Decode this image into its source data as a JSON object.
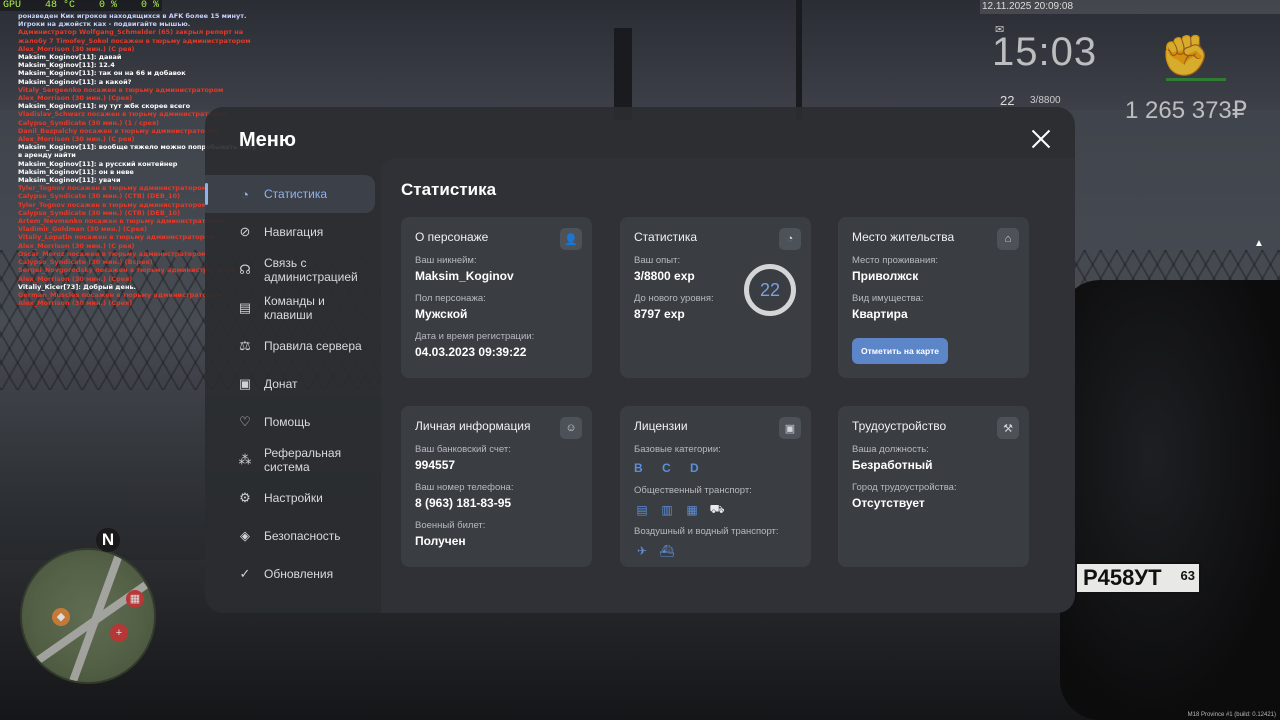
{
  "hud": {
    "gpu": "GPU    48 °C    0 %    0 %",
    "date": "12.11.2025 20:09:08",
    "time": "15:03",
    "level": "22",
    "exp": "3/8800",
    "money": "1 265 373₽",
    "build": "M18 Province #1 (build: 0.12421)",
    "mail_icon": "mail-icon",
    "fist_icon": "fist-icon"
  },
  "chat": [
    {
      "t": "ронзведен Кик игроков находящихся в AFK более 15 минут. Игроки на джойстк ках - подвигайте мышью.",
      "c": "c-b"
    },
    {
      "t": "Администратор Wolfgang_Schmelder (65) закрыл репорт на жалобу 7 Timofey_Sokol посажен в тюрьму администратором Alex_Morrison (30 мин.) (С рея)",
      "c": "c-r"
    },
    {
      "t": "Maksim_Koginov[11]: давай",
      "c": "c-w"
    },
    {
      "t": "Maksim_Koginov[11]: 12.4",
      "c": "c-w"
    },
    {
      "t": "Maksim_Koginov[11]: так он на 66 и добавок",
      "c": "c-w"
    },
    {
      "t": "Maksim_Koginov[11]: а какой?",
      "c": "c-w"
    },
    {
      "t": "Vitaly_Sergeenko посажен в тюрьму администратором Alex_Morrison (30 мин.) (Срея)",
      "c": "c-r"
    },
    {
      "t": "Maksim_Koginov[11]: ну тут жбк скорее всего",
      "c": "c-w"
    },
    {
      "t": "Vladislav_Schwarz посажен в тюрьму администратором Calypso_Syndicate (30 мин.) (1 / срея)",
      "c": "c-r"
    },
    {
      "t": "Danil_Bezpalchy посажен в тюрьму администратором Alex_Morrison (30 мин.) (С рея)",
      "c": "c-r"
    },
    {
      "t": "Maksim_Koginov[11]: вообще тяжело можно попробывать хату в аренду найти",
      "c": "c-w"
    },
    {
      "t": "Maksim_Koginov[11]: а русский контейнер",
      "c": "c-w"
    },
    {
      "t": "Maksim_Koginov[11]: он в неве",
      "c": "c-w"
    },
    {
      "t": "Maksim_Koginov[11]: увачи",
      "c": "c-w"
    },
    {
      "t": "Tyler_Tognov посажен в тюрьму администратором Calypso_Syndicate (30 мин.) (СТВ) (DEB_10)",
      "c": "c-r"
    },
    {
      "t": "Tyler_Tognov посажен в тюрьму администратором Calypso_Syndicate (30 мин.) (СТВ) (DEB_10)",
      "c": "c-r"
    },
    {
      "t": "Artem_Nevmenko посажен в тюрьму администратором Vladimir_Goldman (30 мин.) (Срея)",
      "c": "c-r"
    },
    {
      "t": "Vitaliy_Lopatin посажен в тюрьму администратором Alex_Morrison (30 мин.) (С рея)",
      "c": "c-r"
    },
    {
      "t": "Oscar_Moroz посажен в тюрьму администратором Calypso_Syndicate (30 мин.) (Всрея)",
      "c": "c-r"
    },
    {
      "t": "Sergei_Novgorodsky посажен в тюрьму администратором Alex_Morrison (30 мин.) (Срея)",
      "c": "c-r"
    },
    {
      "t": "Vitaliy_Kicer[73]: Добрый день.",
      "c": "c-w"
    },
    {
      "t": "German_Muscles посажен в тюрьму администратором Alex_Morrison (30 мин.) (Срея)",
      "c": "c-r"
    }
  ],
  "plate": {
    "number": "Р458УТ",
    "region": "63"
  },
  "minimap": {
    "north": "N"
  },
  "menu": {
    "title": "Меню",
    "close_icon": "close-icon",
    "nav": [
      {
        "label": "Статистика",
        "icon": "◔",
        "active": true
      },
      {
        "label": "Навигация",
        "icon": "⊘"
      },
      {
        "label": "Связь с\nадминистрацией",
        "icon": "☊"
      },
      {
        "label": "Команды и\nклавиши",
        "icon": "▤"
      },
      {
        "label": "Правила сервера",
        "icon": "⚖"
      },
      {
        "label": "Донат",
        "icon": "▣"
      },
      {
        "label": "Помощь",
        "icon": "♡"
      },
      {
        "label": "Реферальная\nсистема",
        "icon": "⁂"
      },
      {
        "label": "Настройки",
        "icon": "⚙"
      },
      {
        "label": "Безопасность",
        "icon": "◈"
      },
      {
        "label": "Обновления",
        "icon": "✓"
      }
    ],
    "content_title": "Статистика",
    "cards": {
      "character": {
        "title": "О персонаже",
        "nickname_label": "Ваш никнейм:",
        "nickname": "Maksim_Koginov",
        "gender_label": "Пол персонажа:",
        "gender": "Мужской",
        "reg_label": "Дата и время регистрации:",
        "reg": "04.03.2023 09:39:22"
      },
      "stats": {
        "title": "Статистика",
        "exp_label": "Ваш опыт:",
        "exp": "3/8800 exp",
        "next_label": "До нового уровня:",
        "next": "8797 exp",
        "level": "22",
        "level_progress": 0.0003
      },
      "residence": {
        "title": "Место жительства",
        "place_label": "Место проживания:",
        "place": "Приволжск",
        "property_label": "Вид имущества:",
        "property": "Квартира",
        "map_button": "Отметить на карте"
      },
      "personal": {
        "title": "Личная информация",
        "bank_label": "Ваш банковский счет:",
        "bank": "994557",
        "phone_label": "Ваш номер телефона:",
        "phone": "8 (963) 181-83-95",
        "military_label": "Военный билет:",
        "military": "Получен"
      },
      "licenses": {
        "title": "Лицензии",
        "base_label": "Базовые категории:",
        "base": "B C D",
        "public_label": "Общественный транспорт:",
        "air_label": "Воздушный и водный транспорт:"
      },
      "employment": {
        "title": "Трудоустройство",
        "position_label": "Ваша должность:",
        "position": "Безработный",
        "city_label": "Город трудоустройства:",
        "city": "Отсутствует"
      }
    }
  }
}
